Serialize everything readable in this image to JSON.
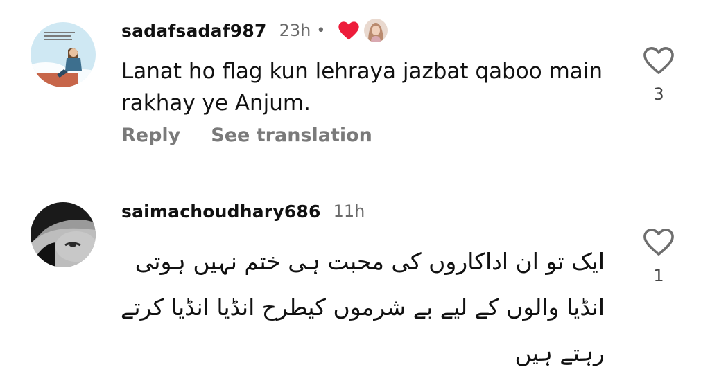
{
  "comments": [
    {
      "username": "sadafsadaf987",
      "time": "23h",
      "separator": "•",
      "liked_by_creator": true,
      "text": "Lanat ho flag kun lehraya jazbat qaboo main rakhay ye Anjum.",
      "actions": {
        "reply": "Reply",
        "see_translation": "See translation"
      },
      "like_count": "3",
      "like_icon": "heart-outline-icon",
      "accent_color": "#ed1c3a"
    },
    {
      "username": "saimachoudhary686",
      "time": "11h",
      "text": "ایک تو ان اداکاروں کی محبت ہی ختم نہیں ہوتی انڈیا والوں کے لیے بے شرموں کیطرح انڈیا انڈیا کرتے رہتے ہیں",
      "like_count": "1",
      "like_icon": "heart-outline-icon"
    }
  ]
}
